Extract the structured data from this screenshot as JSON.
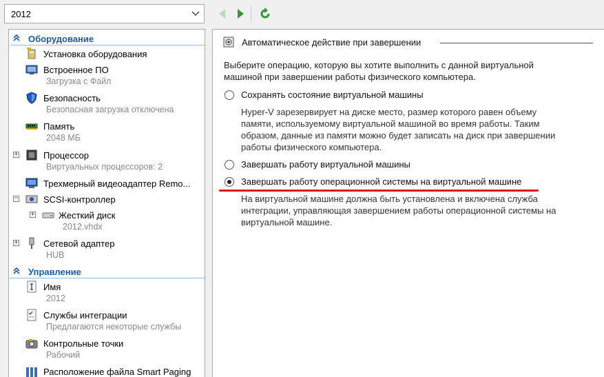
{
  "toolbar": {
    "vm_name": "2012",
    "back_icon": "back-arrow-icon",
    "forward_icon": "forward-arrow-icon",
    "refresh_icon": "refresh-icon"
  },
  "sidebar": {
    "hardware_header": "Оборудование",
    "management_header": "Управление",
    "items": [
      {
        "label": "Установка оборудования",
        "sub": ""
      },
      {
        "label": "Встроенное ПО",
        "sub": "Загрузка с Файл"
      },
      {
        "label": "Безопасность",
        "sub": "Безопасная загрузка отключена"
      },
      {
        "label": "Память",
        "sub": "2048 МБ"
      },
      {
        "label": "Процессор",
        "sub": "Виртуальных процессоров: 2"
      },
      {
        "label": "Трехмерный видеоадаптер Remo...",
        "sub": ""
      },
      {
        "label": "SCSI-контроллер",
        "sub": ""
      },
      {
        "label": "Жесткий диск",
        "sub": "2012.vhdx"
      },
      {
        "label": "Сетевой адаптер",
        "sub": "HUB"
      },
      {
        "label": "Имя",
        "sub": "2012"
      },
      {
        "label": "Службы интеграции",
        "sub": "Предлагаются некоторые службы"
      },
      {
        "label": "Контрольные точки",
        "sub": "Рабочий"
      },
      {
        "label": "Расположение файла Smart Paging",
        "sub": ""
      }
    ]
  },
  "main": {
    "section_title": "Автоматическое действие при завершении",
    "intro": [
      "Выберите операцию, которую вы хотите выполнить с данной виртуальной",
      "машиной при завершении работы физического компьютера."
    ],
    "options": [
      {
        "label": "Сохранять состояние виртуальной машины",
        "checked": false,
        "desc": [
          "Hyper-V зарезервирует на диске место, размер которого равен объему",
          "памяти, используемому виртуальной машиной во время работы. Таким",
          "образом, данные из памяти можно будет записать на диск при завершении",
          "работы физического компьютера."
        ]
      },
      {
        "label": "Завершать работу виртуальной машины",
        "checked": false,
        "desc": []
      },
      {
        "label": "Завершать работу операционной системы на виртуальной машине",
        "checked": true,
        "desc": [
          "На виртуальной машине должна быть установлена и включена служба",
          "интеграции, управляющая завершением работы операционной системы на",
          "виртуальной машине."
        ]
      }
    ],
    "underline_color": "#e0141e"
  }
}
